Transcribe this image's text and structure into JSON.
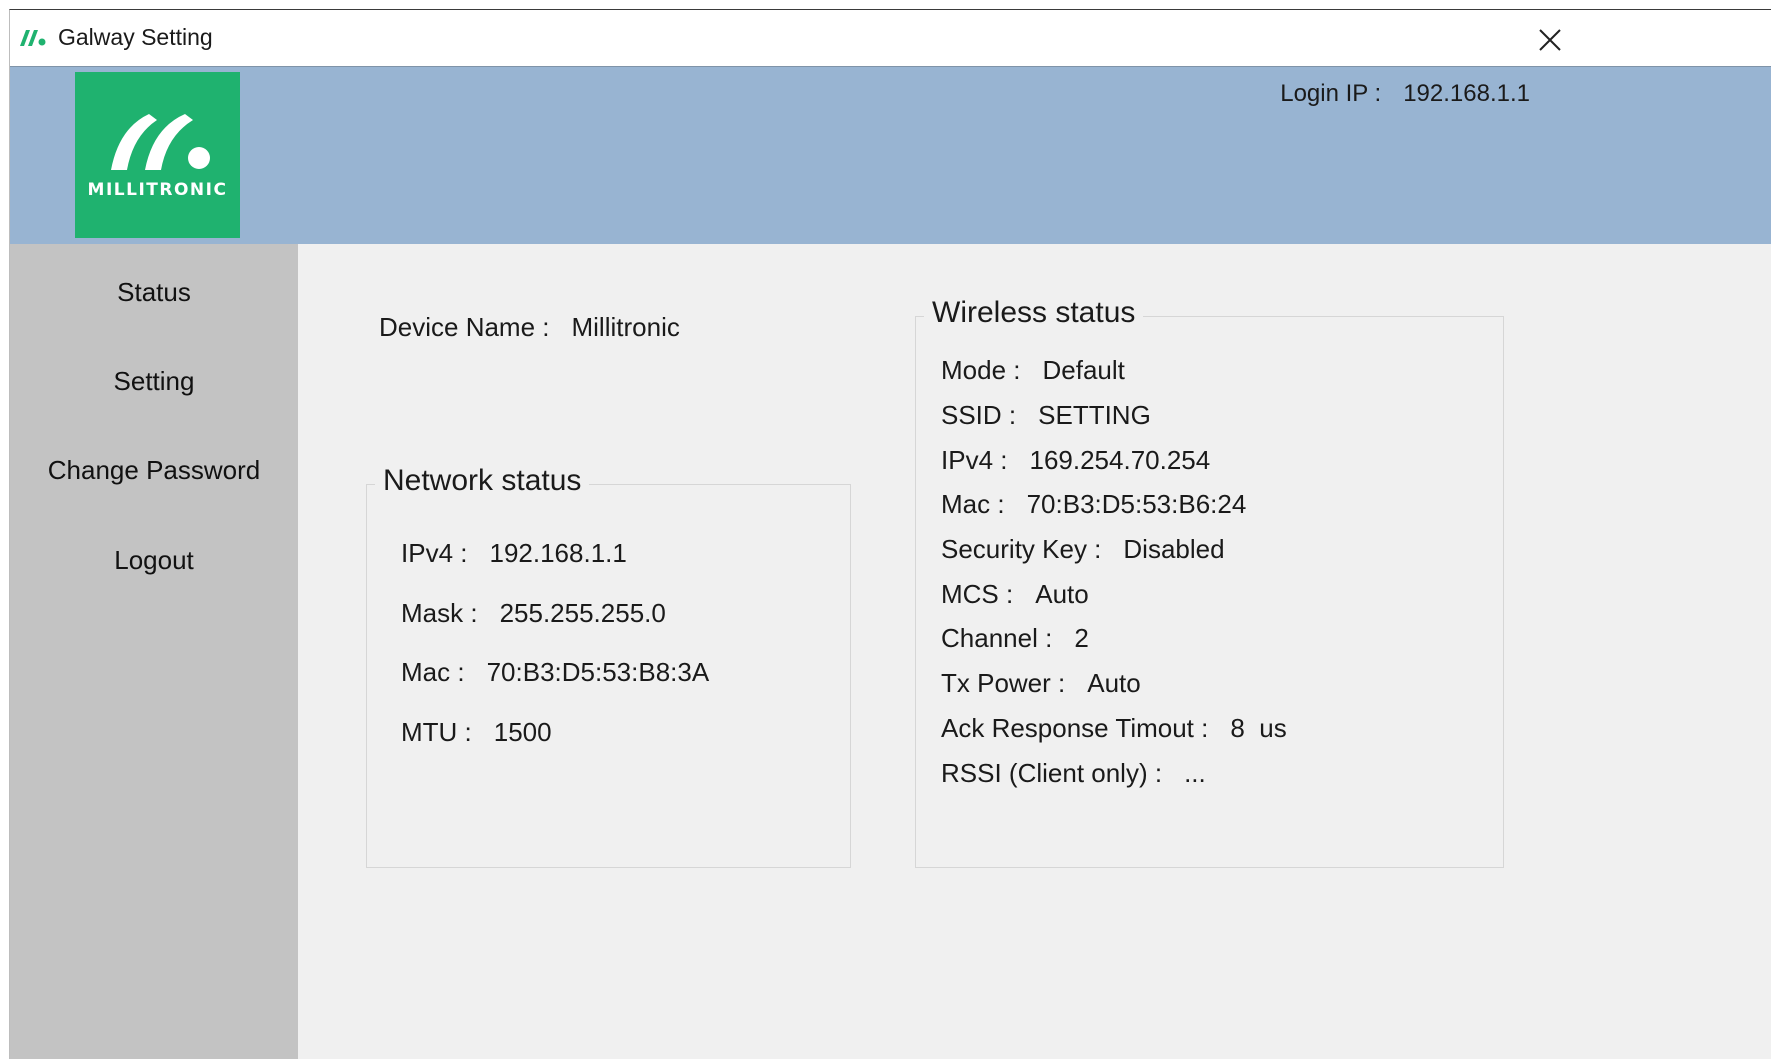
{
  "window": {
    "title": "Galway Setting"
  },
  "header": {
    "logo_text": "MILLITRONIC",
    "login_ip": {
      "label": "Login IP :",
      "value": "192.168.1.1"
    }
  },
  "sidebar": {
    "items": [
      {
        "label": "Status"
      },
      {
        "label": "Setting"
      },
      {
        "label": "Change Password"
      },
      {
        "label": "Logout"
      }
    ]
  },
  "main": {
    "device_name": {
      "label": "Device Name :",
      "value": "Millitronic"
    },
    "network_status": {
      "title": "Network status",
      "rows": [
        {
          "label": "IPv4 :",
          "value": "192.168.1.1"
        },
        {
          "label": "Mask :",
          "value": "255.255.255.0"
        },
        {
          "label": "Mac :",
          "value": "70:B3:D5:53:B8:3A"
        },
        {
          "label": "MTU :",
          "value": "1500"
        }
      ]
    },
    "wireless_status": {
      "title": "Wireless status",
      "rows": [
        {
          "label": "Mode :",
          "value": "Default"
        },
        {
          "label": "SSID :",
          "value": "SETTING"
        },
        {
          "label": "IPv4 :",
          "value": "169.254.70.254"
        },
        {
          "label": "Mac :",
          "value": "70:B3:D5:53:B6:24"
        },
        {
          "label": "Security Key :",
          "value": "Disabled"
        },
        {
          "label": "MCS :",
          "value": "Auto"
        },
        {
          "label": "Channel :",
          "value": "2"
        },
        {
          "label": "Tx Power :",
          "value": "Auto"
        },
        {
          "label": "Ack Response Timout :",
          "value": "8  us"
        },
        {
          "label": "RSSI (Client only) :",
          "value": "..."
        }
      ]
    }
  },
  "colors": {
    "header_bg": "#98b4d2",
    "logo_bg": "#1fb26f",
    "sidebar_bg": "#c3c3c3",
    "content_bg": "#f0f0f0"
  },
  "icons": {
    "app": "millitronic-logo-icon",
    "close": "close-icon"
  }
}
